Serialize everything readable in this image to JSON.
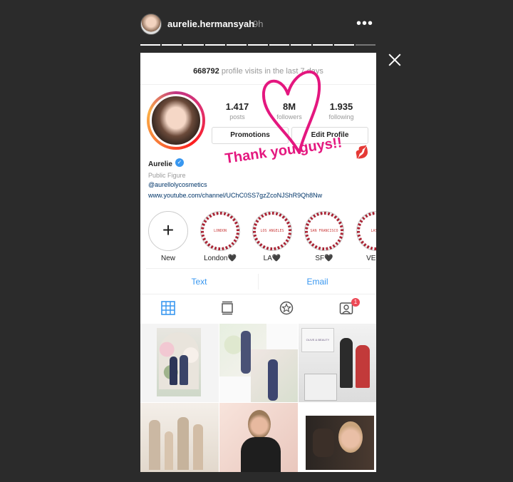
{
  "story": {
    "username": "aurelie.hermansyah",
    "time": "9h",
    "more_label": "•••",
    "segments_total": 11,
    "segments_viewed": 10
  },
  "profile": {
    "visits_count": "668792",
    "visits_text": "profile visits in the last 7 days",
    "posts_num": "1.417",
    "posts_label": "posts",
    "followers_num": "8M",
    "followers_label": "followers",
    "following_num": "1.935",
    "following_label": "following",
    "promotions_label": "Promotions",
    "edit_label": "Edit Profile",
    "name": "Aurelie",
    "category": "Public Figure",
    "handle": "@aurellolycosmetics",
    "link": "www.youtube.com/channel/UChC0SS7gzZcoNJShR9Qh8Nw"
  },
  "highlights": [
    {
      "label": "New",
      "cover": ""
    },
    {
      "label": "London🖤",
      "cover": "LONDON"
    },
    {
      "label": "LA🖤",
      "cover": "LOS ANGELES"
    },
    {
      "label": "SF🖤",
      "cover": "SAN FRANCISCO"
    },
    {
      "label": "VEGA",
      "cover": "LAS V"
    }
  ],
  "contact": {
    "text_label": "Text",
    "email_label": "Email"
  },
  "tabs": {
    "badge": "1",
    "icons": [
      "grid-icon",
      "feed-icon",
      "igtv-icon",
      "tagged-icon"
    ]
  },
  "overlay": {
    "thanks": "Thank you guys!!",
    "lips": "💋"
  },
  "grid_posts": [
    {
      "overlay_text": ""
    },
    {
      "overlay_text": ""
    },
    {
      "overlay_text": "OLIVE & BEAUTY"
    },
    {
      "overlay_text": ""
    },
    {
      "overlay_text": ""
    },
    {
      "overlay_text": ""
    }
  ],
  "colors": {
    "accent": "#3897f0",
    "handwriting": "#e4177f",
    "badge": "#ed4956"
  }
}
